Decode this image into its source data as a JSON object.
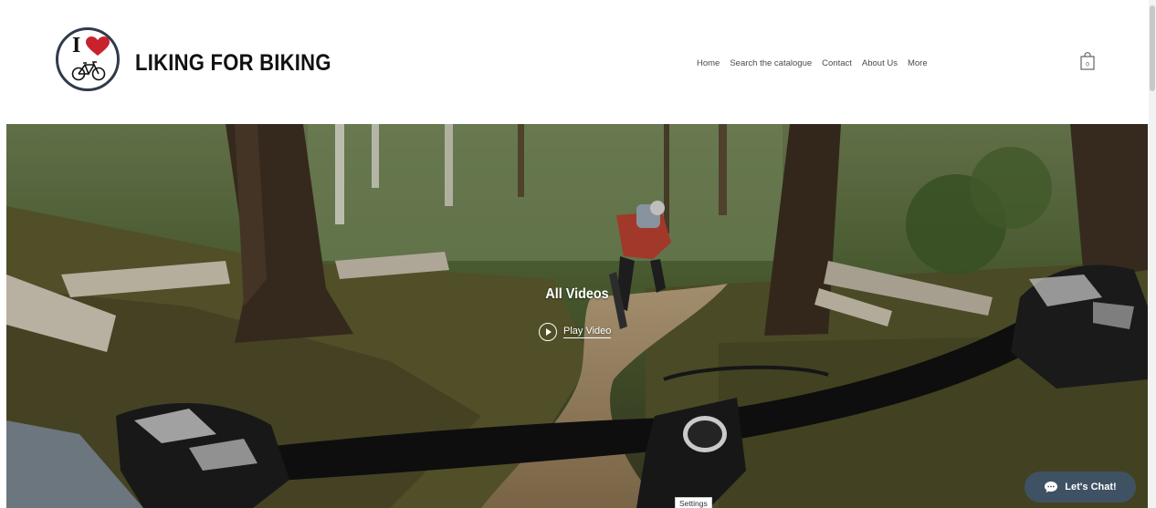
{
  "site": {
    "logo_letter": "I",
    "title": "LIKING FOR BIKING"
  },
  "nav": {
    "items": [
      "Home",
      "Search the catalogue",
      "Contact",
      "About Us",
      "More"
    ]
  },
  "cart": {
    "count": "0"
  },
  "hero": {
    "title": "All Videos",
    "play_label": "Play Video"
  },
  "chat": {
    "label": "Let's Chat!"
  },
  "settings_label": "Settings",
  "colors": {
    "heart": "#c8232c",
    "chat_bg": "#3f5263",
    "logo_ring": "#2f3b4a"
  }
}
